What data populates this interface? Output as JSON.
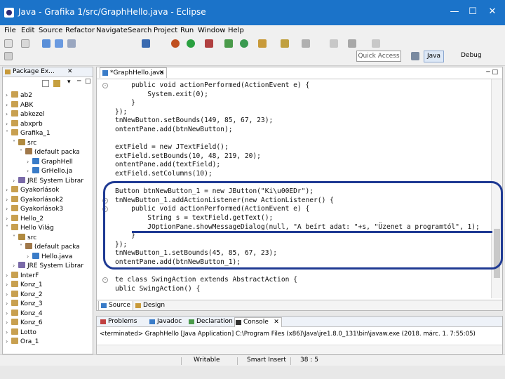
{
  "window": {
    "title": "Java - Grafika 1/src/GraphHello.java - Eclipse"
  },
  "menu": [
    "File",
    "Edit",
    "Source",
    "Refactor",
    "Navigate",
    "Search",
    "Project",
    "Run",
    "Window",
    "Help"
  ],
  "toolbar": {
    "quick_access_placeholder": "Quick Access",
    "perspective_java": "Java",
    "perspective_debug": "Debug"
  },
  "package_explorer": {
    "tab_label": "Package Ex...",
    "tree": [
      {
        "label": "ab2",
        "icon": "project-icon",
        "level": 0,
        "twisty": ">"
      },
      {
        "label": "ABK",
        "icon": "project-icon",
        "level": 0,
        "twisty": ">"
      },
      {
        "label": "abkezel",
        "icon": "project-icon",
        "level": 0,
        "twisty": ">"
      },
      {
        "label": "abxprb",
        "icon": "project-icon",
        "level": 0,
        "twisty": ">"
      },
      {
        "label": "Grafika_1",
        "icon": "project-icon",
        "level": 0,
        "twisty": "v"
      },
      {
        "label": "src",
        "icon": "src-folder-icon",
        "level": 1,
        "twisty": "v"
      },
      {
        "label": "(default packa",
        "icon": "package-icon",
        "level": 2,
        "twisty": "v"
      },
      {
        "label": "GraphHell",
        "icon": "java-file-icon",
        "level": 3,
        "twisty": ">"
      },
      {
        "label": "GrHello.ja",
        "icon": "java-file-icon",
        "level": 3,
        "twisty": ">"
      },
      {
        "label": "JRE System Librar",
        "icon": "library-icon",
        "level": 1,
        "twisty": ">"
      },
      {
        "label": "Gyakorlások",
        "icon": "project-icon",
        "level": 0,
        "twisty": ">"
      },
      {
        "label": "Gyakorlások2",
        "icon": "project-icon",
        "level": 0,
        "twisty": ">"
      },
      {
        "label": "Gyakorlások3",
        "icon": "project-icon",
        "level": 0,
        "twisty": ">"
      },
      {
        "label": "Hello_2",
        "icon": "project-icon",
        "level": 0,
        "twisty": ">"
      },
      {
        "label": "Hello Világ",
        "icon": "project-icon",
        "level": 0,
        "twisty": "v"
      },
      {
        "label": "src",
        "icon": "src-folder-icon",
        "level": 1,
        "twisty": "v"
      },
      {
        "label": "(default packa",
        "icon": "package-icon",
        "level": 2,
        "twisty": "v"
      },
      {
        "label": "Hello.java",
        "icon": "java-file-icon",
        "level": 3,
        "twisty": ">"
      },
      {
        "label": "JRE System Librar",
        "icon": "library-icon",
        "level": 1,
        "twisty": ">"
      },
      {
        "label": "InterF",
        "icon": "project-icon",
        "level": 0,
        "twisty": ">"
      },
      {
        "label": "Konz_1",
        "icon": "project-icon",
        "level": 0,
        "twisty": ">"
      },
      {
        "label": "Konz_2",
        "icon": "project-icon",
        "level": 0,
        "twisty": ">"
      },
      {
        "label": "Konz_3",
        "icon": "project-icon",
        "level": 0,
        "twisty": ">"
      },
      {
        "label": "Konz_4",
        "icon": "project-icon",
        "level": 0,
        "twisty": ">"
      },
      {
        "label": "Konz_6",
        "icon": "project-icon",
        "level": 0,
        "twisty": ">"
      },
      {
        "label": "Lotto",
        "icon": "project-icon",
        "level": 0,
        "twisty": ">"
      },
      {
        "label": "Ora_1",
        "icon": "project-icon",
        "level": 0,
        "twisty": ">"
      }
    ]
  },
  "editor": {
    "tab_label": "*GraphHello.java",
    "lines": [
      "    public void actionPerformed(ActionEvent e) {",
      "        System.exit(0);",
      "    }",
      "});",
      "tnNewButton.setBounds(149, 85, 67, 23);",
      "ontentPane.add(btnNewButton);",
      "",
      "extField = new JTextField();",
      "extField.setBounds(10, 48, 219, 20);",
      "ontentPane.add(textField);",
      "extField.setColumns(10);",
      "",
      "Button btnNewButton_1 = new JButton(\"Ki\\u00EDr\");",
      "tnNewButton_1.addActionListener(new ActionListener() {",
      "    public void actionPerformed(ActionEvent e) {",
      "        String s = textField.getText();",
      "        JOptionPane.showMessageDialog(null, \"A beírt adat: \"+s, \"Üzenet a programtól\", 1);",
      "    }",
      "});",
      "tnNewButton_1.setBounds(45, 85, 67, 23);",
      "ontentPane.add(btnNewButton_1);",
      "",
      "te class SwingAction extends AbstractAction {",
      "ublic SwingAction() {"
    ],
    "bottom_tabs": [
      "Source",
      "Design"
    ]
  },
  "bottom_panel": {
    "tabs": [
      "Problems",
      "Javadoc",
      "Declaration",
      "Console"
    ],
    "console_text": "<terminated> GraphHello [Java Application] C:\\Program Files (x86)\\Java\\jre1.8.0_131\\bin\\javaw.exe (2018. márc. 1. 7:55:05)"
  },
  "status": {
    "writable": "Writable",
    "insert_mode": "Smart Insert",
    "position": "38 : 5"
  },
  "colors": {
    "titlebar": "#1b73c9",
    "annotation": "#1f3a93"
  }
}
